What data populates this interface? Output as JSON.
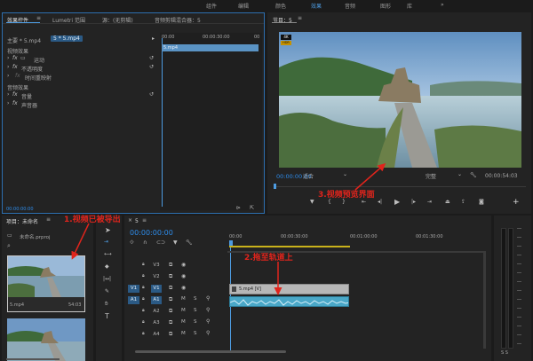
{
  "topnav": {
    "items": [
      "组件",
      "编辑",
      "颜色",
      "效果",
      "音频",
      "图形",
      "库"
    ],
    "active_index": 3,
    "more": "»"
  },
  "effect_controls": {
    "tabs": [
      "效果控件",
      "Lumetri 范围",
      "源：(无剪辑)",
      "音频剪辑混合器：5"
    ],
    "menu_icon": "≡",
    "clip_left": "主要 * 5.mp4",
    "clip_right": "5 * 5.mp4",
    "timecode_ruler": "00:00:30:00",
    "ruler_start": "00:00",
    "ruler_end": "00",
    "clip_bar": "5.mp4",
    "sections": [
      {
        "label": "视频效果",
        "items": [
          "运动",
          "不透明度",
          "时间重映射"
        ]
      },
      {
        "label": "音频效果",
        "items": [
          "音量",
          "声音器"
        ]
      }
    ],
    "footer_tc": "00:00:00:00"
  },
  "program": {
    "title": "节目：5",
    "menu_icon": "≡",
    "badge_4k": "4K",
    "badge_hdr": "HDR",
    "timecode": "00:00:00:00",
    "fit": "适合",
    "quality": "完整",
    "duration": "00:00:54:03",
    "plus": "+"
  },
  "project": {
    "title": "项目：未命名",
    "menu_icon": "≡",
    "filename": "未命名.prproj",
    "search_icon": "⌕",
    "clips": [
      {
        "name": "5.mp4",
        "duration": "54:03"
      },
      {
        "name": "",
        "duration": ""
      }
    ]
  },
  "timeline": {
    "title": "5",
    "menu_icon": "≡",
    "timecode": "00:00:00:00",
    "ruler": [
      "00:00",
      "00:00:30:00",
      "00:01:00:00",
      "00:01:30:00"
    ],
    "video_tracks": [
      "V3",
      "V2",
      "V1"
    ],
    "audio_tracks": [
      "A1",
      "A2",
      "A3",
      "A4"
    ],
    "src_v": "V1",
    "src_a": "A1",
    "m": "M",
    "s": "S",
    "video_clip": "5.mp4 [V]",
    "audio_meter_label": "S  S"
  },
  "annotations": [
    {
      "id": "a1",
      "text": "1.视频已被导出"
    },
    {
      "id": "a2",
      "text": "2.拖至轨道上"
    },
    {
      "id": "a3",
      "text": "3.视频预览界面"
    }
  ],
  "colors": {
    "accent_blue": "#2d8ceb",
    "annotation_red": "#e0241c",
    "clip_teal": "#4aa8c8"
  }
}
